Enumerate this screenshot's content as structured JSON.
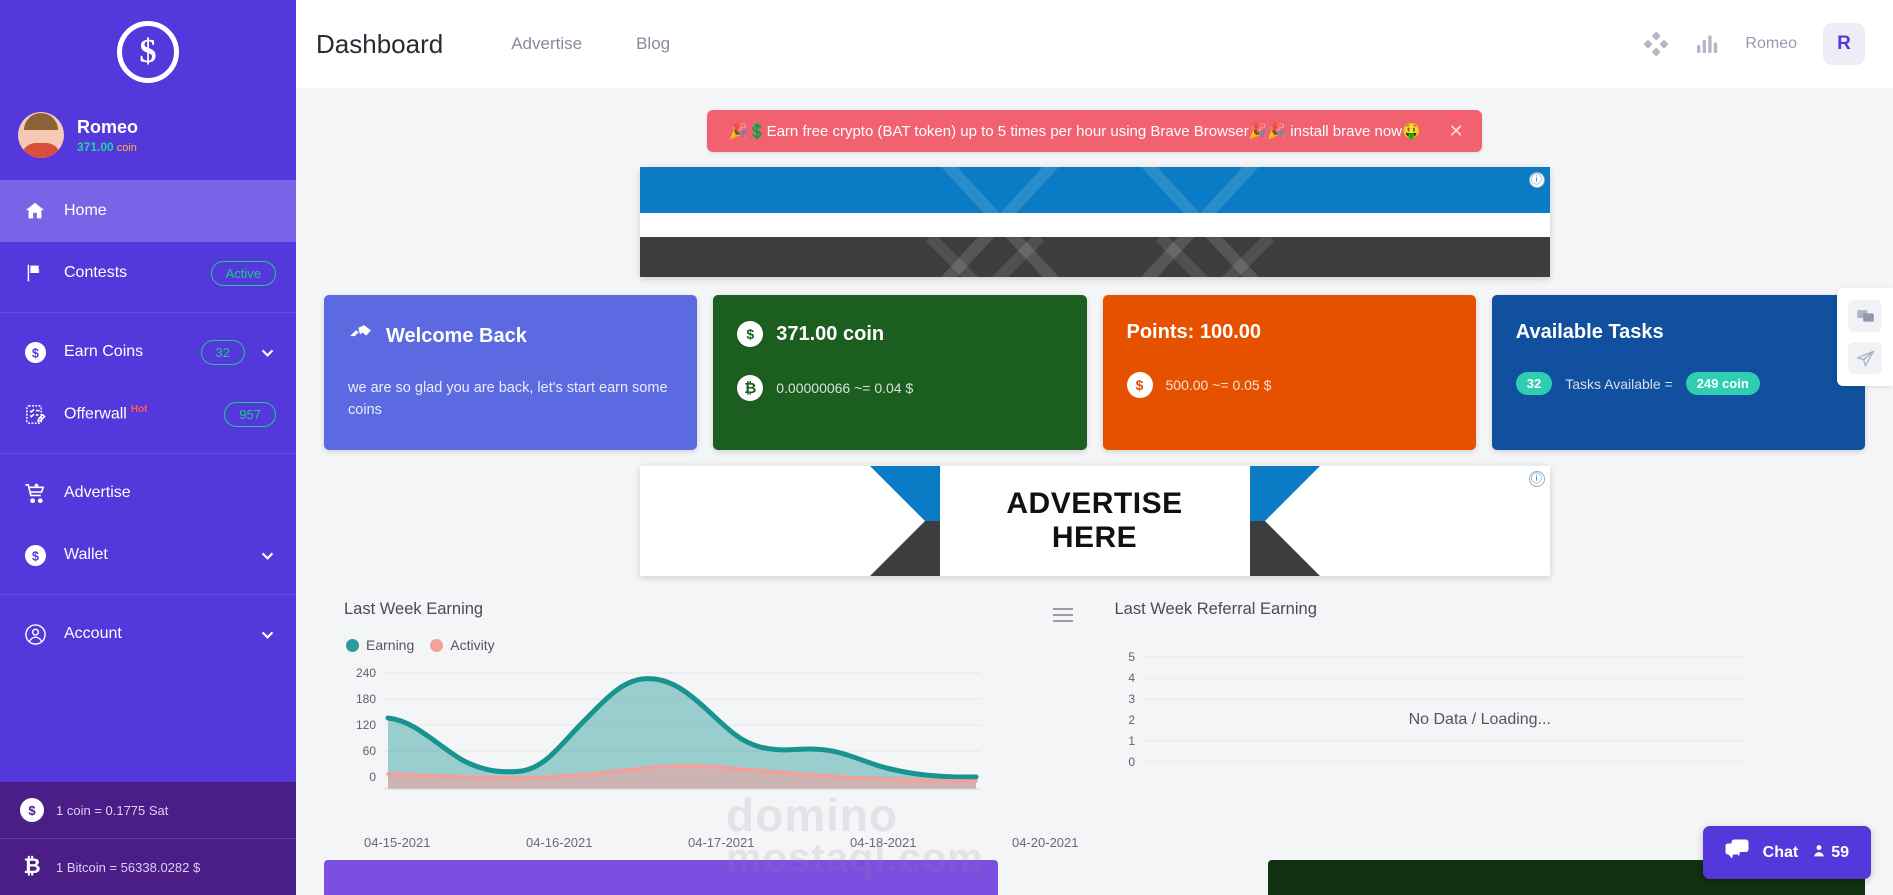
{
  "sidebar": {
    "logo_glyph": "$",
    "profile": {
      "name": "Romeo",
      "balance": "371.00",
      "unit": "coin"
    },
    "groups": [
      {
        "items": [
          {
            "label": "Home",
            "icon": "home-icon",
            "active": true
          },
          {
            "label": "Contests",
            "icon": "flag-icon",
            "badge": "Active"
          }
        ]
      },
      {
        "items": [
          {
            "label": "Earn Coins",
            "icon": "coin-icon",
            "badge": "32",
            "chevron": true
          },
          {
            "label": "Offerwall",
            "icon": "clipboard-icon",
            "tag": "Hot",
            "badge": "957"
          }
        ]
      },
      {
        "items": [
          {
            "label": "Advertise",
            "icon": "cart-icon"
          },
          {
            "label": "Wallet",
            "icon": "coin-icon",
            "chevron": true
          }
        ]
      },
      {
        "items": [
          {
            "label": "Account",
            "icon": "user-circle-icon",
            "chevron": true
          }
        ]
      }
    ],
    "rates": [
      {
        "icon": "coin-icon",
        "text": "1 coin = 0.1775 Sat"
      },
      {
        "icon": "bitcoin-icon",
        "text": "1 Bitcoin = 56338.0282 $"
      }
    ]
  },
  "header": {
    "title": "Dashboard",
    "nav": [
      {
        "label": "Advertise"
      },
      {
        "label": "Blog"
      }
    ],
    "user_name": "Romeo",
    "avatar_initial": "R"
  },
  "alert": {
    "text": "🎉💲Earn free crypto (BAT token) up to 5 times per hour using Brave Browser🎉🎉 install brave now🤑",
    "close": "✕"
  },
  "banners": {
    "top": {
      "text": "",
      "badge": "ⓘ"
    },
    "middle": {
      "line1": "ADVERTISE",
      "line2": "HERE",
      "badge": "ⓘ"
    }
  },
  "cards": [
    {
      "id": "welcome",
      "title": "Welcome Back",
      "icon": "handshake-icon",
      "body": "we are so glad you are back, let's start earn some coins",
      "color": "#5b6ae0"
    },
    {
      "id": "coin-balance",
      "title": "371.00 coin",
      "icon": "coin-icon",
      "sub_icon": "bitcoin-icon",
      "sub": "0.00000066 ~= 0.04 $",
      "color": "#1b5e20"
    },
    {
      "id": "points",
      "title": "Points: 100.00",
      "sub_icon": "dollar-icon",
      "sub": "500.00 ~= 0.05 $",
      "color": "#e65100"
    },
    {
      "id": "available-tasks",
      "title": "Available Tasks",
      "badge_count": "32",
      "sub": "Tasks Available =",
      "badge_reward": "249 coin",
      "color": "#11509e"
    }
  ],
  "chart_data": [
    {
      "type": "area",
      "title": "Last Week Earning",
      "xlabel": "",
      "ylabel": "",
      "categories": [
        "04-15-2021",
        "04-16-2021",
        "04-17-2021",
        "04-18-2021",
        "04-20-2021"
      ],
      "x_ticks": [
        "04-15-2021",
        "04-16-2021",
        "04-17-2021",
        "04-18-2021",
        "04-20-2021"
      ],
      "y_ticks": [
        0,
        60,
        120,
        180,
        240
      ],
      "ylim": [
        0,
        240
      ],
      "grid": true,
      "legend": [
        "Earning",
        "Activity"
      ],
      "legend_position": "top-left",
      "series": [
        {
          "name": "Earning",
          "color": "#2a9d9b",
          "values": [
            137,
            22,
            225,
            85,
            5
          ]
        },
        {
          "name": "Activity",
          "color": "#f4a09a",
          "values": [
            7,
            2,
            26,
            14,
            2
          ]
        }
      ]
    },
    {
      "type": "line",
      "title": "Last Week Referral Earning",
      "xlabel": "",
      "ylabel": "",
      "categories": [],
      "y_ticks": [
        0,
        1,
        2,
        3,
        4,
        5
      ],
      "ylim": [
        0,
        5
      ],
      "grid": true,
      "empty_message": "No Data / Loading...",
      "series": []
    }
  ],
  "watermark": {
    "line1": "domino",
    "line2": "mostaql.com"
  },
  "dock": [
    {
      "icon": "chat-bubble-icon"
    },
    {
      "icon": "paper-plane-icon"
    }
  ],
  "chat_fab": {
    "label": "Chat",
    "count": "59",
    "icon": "chat-icon"
  }
}
